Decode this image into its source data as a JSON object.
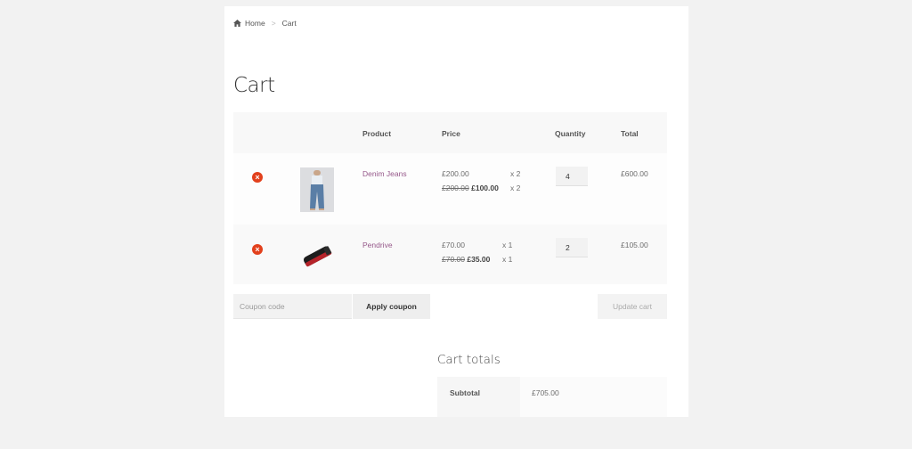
{
  "breadcrumb": {
    "home": "Home",
    "current": "Cart"
  },
  "page_title": "Cart",
  "table": {
    "headers": {
      "product": "Product",
      "price": "Price",
      "quantity": "Quantity",
      "total": "Total"
    },
    "rows": [
      {
        "remove_icon": "remove-circle-icon",
        "product": "Denim Jeans",
        "price_regular": "£200.00",
        "qty_tag_1": "x 2",
        "price_old": "£200.00",
        "price_sale": "£100.00",
        "qty_tag_2": "x 2",
        "quantity": "4",
        "total": "£600.00"
      },
      {
        "remove_icon": "remove-circle-icon",
        "product": "Pendrive",
        "price_regular": "£70.00",
        "qty_tag_1": "x 1",
        "price_old": "£70.00",
        "price_sale": "£35.00",
        "qty_tag_2": "x 1",
        "quantity": "2",
        "total": "£105.00"
      }
    ]
  },
  "coupon": {
    "placeholder": "Coupon code",
    "apply_label": "Apply coupon"
  },
  "update_label": "Update cart",
  "totals": {
    "title": "Cart totals",
    "subtotal_label": "Subtotal",
    "subtotal_value": "£705.00"
  },
  "colors": {
    "accent": "#96588a",
    "remove": "#e2401c",
    "background": "#f2f2f2"
  }
}
